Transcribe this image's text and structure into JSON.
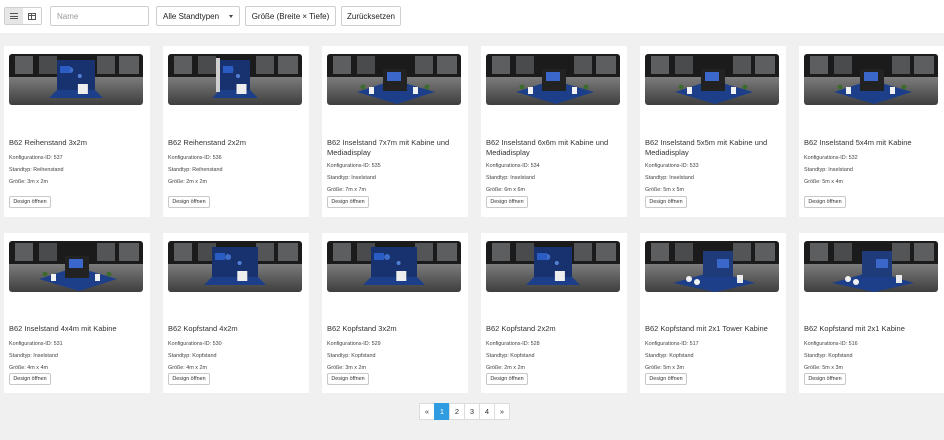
{
  "toolbar": {
    "search_placeholder": "Name",
    "type_filter": "Alle Standtypen",
    "size_filter": "Größe (Breite × Tiefe)",
    "reset": "Zurücksetzen"
  },
  "icons": {
    "list_view": "list-icon",
    "grid_view": "grid-icon",
    "dropdown": "chevron-down-icon"
  },
  "colors": {
    "accent": "#2f9be0",
    "booth_blue": "#1d3f8a",
    "card_bg": "#ffffff",
    "page_bg": "#f0f0f0"
  },
  "labels": {
    "config_prefix": "Konfigurations-ID:",
    "type_prefix": "Standtyp:",
    "size_prefix": "Größe:",
    "open_button": "Design öffnen"
  },
  "cards": [
    {
      "title": "B62 Reihenstand 3x2m",
      "config_id": "Konfigurations-ID: 537",
      "type": "Standtyp: Reihenstand",
      "size": "Größe: 3m x 2m",
      "open": "Design öffnen"
    },
    {
      "title": "B62 Reihenstand 2x2m",
      "config_id": "Konfigurations-ID: 536",
      "type": "Standtyp: Reihenstand",
      "size": "Größe: 2m x 2m",
      "open": "Design öffnen"
    },
    {
      "title": "B62 Inselstand 7x7m mit Kabine und Mediadisplay",
      "config_id": "Konfigurations-ID: 535",
      "type": "Standtyp: Inselstand",
      "size": "Größe: 7m x 7m",
      "open": "Design öffnen"
    },
    {
      "title": "B62 Inselstand 6x6m mit Kabine und Mediadisplay",
      "config_id": "Konfigurations-ID: 534",
      "type": "Standtyp: Inselstand",
      "size": "Größe: 6m x 6m",
      "open": "Design öffnen"
    },
    {
      "title": "B62 Inselstand 5x5m mit Kabine und Mediadisplay",
      "config_id": "Konfigurations-ID: 533",
      "type": "Standtyp: Inselstand",
      "size": "Größe: 5m x 5m",
      "open": "Design öffnen"
    },
    {
      "title": "B62 Inselstand 5x4m mit Kabine",
      "config_id": "Konfigurations-ID: 532",
      "type": "Standtyp: Inselstand",
      "size": "Größe: 5m x 4m",
      "open": "Design öffnen"
    },
    {
      "title": "B62 Inselstand 4x4m mit Kabine",
      "config_id": "Konfigurations-ID: 531",
      "type": "Standtyp: Inselstand",
      "size": "Größe: 4m x 4m",
      "open": "Design öffnen"
    },
    {
      "title": "B62 Kopfstand 4x2m",
      "config_id": "Konfigurations-ID: 530",
      "type": "Standtyp: Kopfstand",
      "size": "Größe: 4m x 2m",
      "open": "Design öffnen"
    },
    {
      "title": "B62 Kopfstand 3x2m",
      "config_id": "Konfigurations-ID: 529",
      "type": "Standtyp: Kopfstand",
      "size": "Größe: 3m x 2m",
      "open": "Design öffnen"
    },
    {
      "title": "B62 Kopfstand 2x2m",
      "config_id": "Konfigurations-ID: 528",
      "type": "Standtyp: Kopfstand",
      "size": "Größe: 2m x 2m",
      "open": "Design öffnen"
    },
    {
      "title": "B62 Kopfstand mit 2x1 Tower Kabine",
      "config_id": "Konfigurations-ID: 517",
      "type": "Standtyp: Kopfstand",
      "size": "Größe: 5m x 3m",
      "open": "Design öffnen"
    },
    {
      "title": "B62 Kopfstand mit 2x1 Kabine",
      "config_id": "Konfigurations-ID: 516",
      "type": "Standtyp: Kopfstand",
      "size": "Größe: 5m x 3m",
      "open": "Design öffnen"
    }
  ],
  "pagination": {
    "prev": "«",
    "pages": [
      "1",
      "2",
      "3",
      "4"
    ],
    "current": "1",
    "next": "»"
  }
}
